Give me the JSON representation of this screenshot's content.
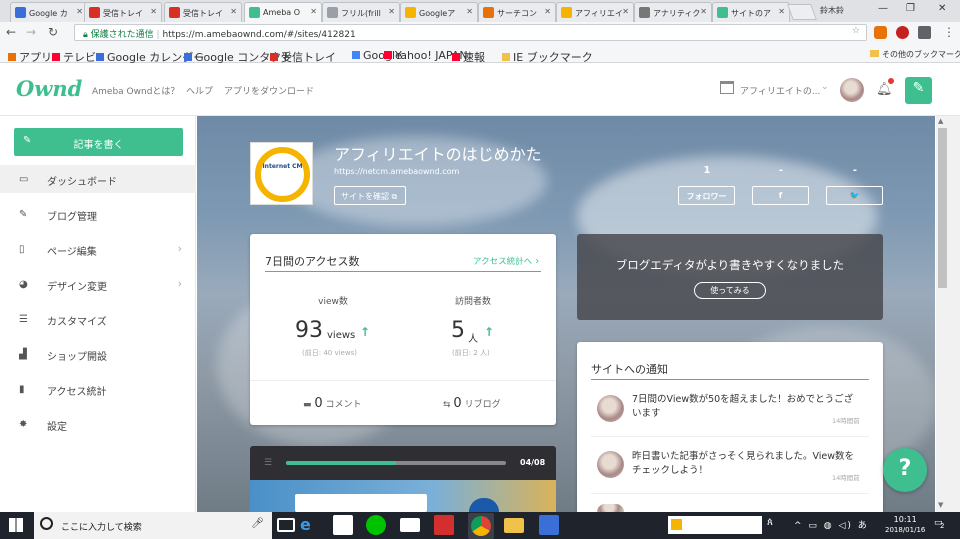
{
  "browser": {
    "tabs": [
      {
        "label": "Google カ",
        "color": "#3b6fd8"
      },
      {
        "label": "受信トレイ",
        "color": "#d93025"
      },
      {
        "label": "受信トレイ",
        "color": "#d93025"
      },
      {
        "label": "Ameba O",
        "color": "#3fbf8f"
      },
      {
        "label": "フリル(frill",
        "color": "#9aa0a6"
      },
      {
        "label": "Googleア",
        "color": "#f5b400"
      },
      {
        "label": "サーチコン",
        "color": "#e8710a"
      },
      {
        "label": "アフィリエイ",
        "color": "#f5b400"
      },
      {
        "label": "アナリティク",
        "color": "#777777"
      },
      {
        "label": "サイトのア",
        "color": "#3fbf8f"
      }
    ],
    "profile_name": "鈴木鈴",
    "window_controls": [
      "—",
      "❐",
      "✕"
    ],
    "secure_label": "保護された通信",
    "url": "https://m.amebaownd.com/#/sites/412821",
    "bookmarks": [
      {
        "label": "アプリ",
        "icon": "apps-grid-icon"
      },
      {
        "label": "テレビ",
        "icon": "yahoo-icon"
      },
      {
        "label": "Google カレンダー",
        "icon": "calendar-icon"
      },
      {
        "label": "Google コンタクト",
        "icon": "contacts-icon"
      },
      {
        "label": "受信トレイ",
        "icon": "gmail-icon"
      },
      {
        "label": "Google",
        "icon": "google-icon"
      },
      {
        "label": "Yahoo! JAPAN",
        "icon": "yahoo-icon"
      },
      {
        "label": "速報",
        "icon": "yahoo-icon"
      },
      {
        "label": "IE ブックマーク",
        "icon": "folder-icon"
      }
    ],
    "other_bookmarks": "その他のブックマーク"
  },
  "header": {
    "logo": "Ownd",
    "nav": [
      "Ameba Owndとは？",
      "ヘルプ",
      "アプリをダウンロード"
    ],
    "site_select": "アフィリエイトの...",
    "accent": "#3fbf8f"
  },
  "sidebar": {
    "write_button": "記事を書く",
    "items": [
      {
        "label": "ダッシュボード",
        "icon": "dashboard-icon",
        "active": true,
        "chevron": false
      },
      {
        "label": "ブログ管理",
        "icon": "edit-icon",
        "active": false,
        "chevron": false
      },
      {
        "label": "ページ編集",
        "icon": "page-icon",
        "active": false,
        "chevron": true
      },
      {
        "label": "デザイン変更",
        "icon": "palette-icon",
        "active": false,
        "chevron": true
      },
      {
        "label": "カスタマイズ",
        "icon": "sliders-icon",
        "active": false,
        "chevron": false
      },
      {
        "label": "ショップ開設",
        "icon": "shop-icon",
        "active": false,
        "chevron": false
      },
      {
        "label": "アクセス統計",
        "icon": "bar-chart-icon",
        "active": false,
        "chevron": false
      },
      {
        "label": "設定",
        "icon": "gear-icon",
        "active": false,
        "chevron": false
      }
    ]
  },
  "site": {
    "logo_text": "Internet CM",
    "title": "アフィリエイトのはじめかた",
    "url": "https://netcm.amebaownd.com",
    "confirm_button": "サイトを確認",
    "stats": [
      {
        "count": "1",
        "button": "フォロワー"
      },
      {
        "count": "-",
        "button": "f"
      },
      {
        "count": "-",
        "button": "🐦"
      }
    ]
  },
  "access": {
    "title": "7日間のアクセス数",
    "link": "アクセス統計へ",
    "views_label": "view数",
    "views_value": "93",
    "views_unit": "views",
    "views_prev": "(前日: 40 views)",
    "visitors_label": "訪問者数",
    "visitors_value": "5",
    "visitors_unit": "人",
    "visitors_prev": "(前日: 2 人)",
    "comments_value": "0",
    "comments_label": "コメント",
    "reblogs_value": "0",
    "reblogs_label": "リブログ"
  },
  "banner": {
    "text": "ブログエディタがより書きやすくなりました",
    "button": "使ってみる"
  },
  "notices": {
    "title": "サイトへの通知",
    "items": [
      {
        "text": "7日間のView数が50を超えました！おめでとうございます",
        "time": "14時間前"
      },
      {
        "text": "昨日書いた記事がさっそく見られました。View数をチェックしよう！",
        "time": "14時間前"
      },
      {
        "text": "",
        "time": ""
      }
    ]
  },
  "tutorial": {
    "progress_text": "04/08",
    "progress": 0.5
  },
  "help_button": "?",
  "taskbar": {
    "search_placeholder": "ここに入力して検索",
    "time": "10:11",
    "date": "2018/01/16",
    "notifications": "2"
  }
}
